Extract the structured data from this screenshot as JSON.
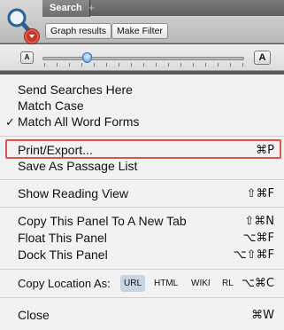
{
  "toolbar": {
    "tab_label": "Search",
    "tab_add": "+",
    "graph_button": "Graph results",
    "filter_button": "Make Filter"
  },
  "font_size": {
    "small_label": "A",
    "large_label": "A",
    "slider_value_fraction": 0.22
  },
  "menu": {
    "send_searches": "Send Searches Here",
    "match_case": "Match Case",
    "match_word_forms": "Match All Word Forms",
    "match_word_forms_checked": "✓",
    "print_export": "Print/Export...",
    "print_export_shortcut": "⌘P",
    "save_passage": "Save As Passage List",
    "reading_view": "Show Reading View",
    "reading_view_shortcut": "⇧⌘F",
    "copy_panel": "Copy This Panel To A New Tab",
    "copy_panel_shortcut": "⇧⌘N",
    "float_panel": "Float This Panel",
    "float_panel_shortcut": "⌥⌘F",
    "dock_panel": "Dock This Panel",
    "dock_panel_shortcut": "⌥⇧⌘F",
    "copy_location_label": "Copy Location As:",
    "copy_location_formats": [
      "URL",
      "HTML",
      "WIKI",
      "RL"
    ],
    "copy_location_selected": "URL",
    "copy_location_shortcut": "⌥⌘C",
    "close": "Close",
    "close_shortcut": "⌘W"
  },
  "colors": {
    "highlight_border": "#e0534a",
    "badge": "#c0392b",
    "slider_thumb": "#5aa0e8"
  },
  "icons": [
    "magnifying-glass-icon",
    "dropdown-arrow-icon",
    "checkmark-icon"
  ]
}
